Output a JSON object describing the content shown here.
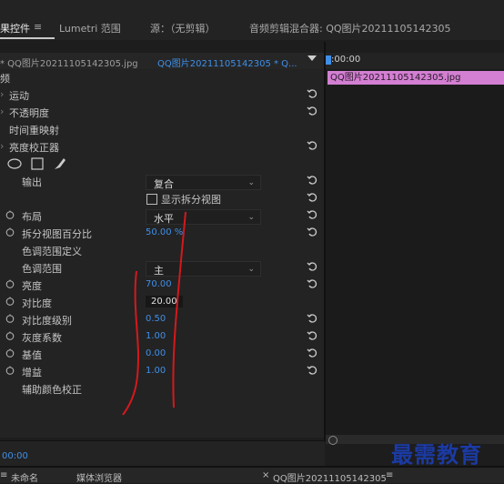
{
  "top_tabs": {
    "effect_controls": "果控件",
    "menu_glyph": "≡",
    "lumetri_scopes": "Lumetri 范围",
    "source": "源：（无剪辑）",
    "audio_mixer": "音频剪辑混合器: QQ图片20211105142305"
  },
  "source_header": {
    "master_clip": "* QQ图片20211105142305.jpg",
    "sequence_clip": "QQ图片20211105142305 * Q..."
  },
  "panel": {
    "fx_header": "频",
    "motion": "运动",
    "opacity": "不透明度",
    "time_remap": "时间重映射",
    "brightness_corrector": "亮度校正器",
    "output_label": "输出",
    "output_value": "复合",
    "show_split_view": "显示拆分视图",
    "layout_label": "布局",
    "layout_value": "水平",
    "split_percent_label": "拆分视图百分比",
    "split_percent_value": "50.00 %",
    "tonal_range_def": "色调范围定义",
    "tonal_range_label": "色调范围",
    "tonal_range_value": "主",
    "brightness_label": "亮度",
    "brightness_value": "70.00",
    "contrast_label": "对比度",
    "contrast_value": "20.00",
    "contrast_level_label": "对比度级别",
    "contrast_level_value": "0.50",
    "gamma_label": "灰度系数",
    "gamma_value": "1.00",
    "pedestal_label": "基值",
    "pedestal_value": "0.00",
    "gain_label": "增益",
    "gain_value": "1.00",
    "secondary_label": "辅助颜色校正"
  },
  "timeline": {
    "timecode": ":00:00",
    "clip_name": "QQ图片20211105142305.jpg"
  },
  "bottom": {
    "current_time": "00:00",
    "tab_untitled": "未命名",
    "tab_media_browser": "媒体浏览器",
    "tab_sequence": "QQ图片20211105142305",
    "menu_glyph": "≡",
    "close_glyph": "×"
  },
  "watermark": "最需教育",
  "colors": {
    "accent_blue": "#3f8fe8",
    "clip_pink": "#d37fd2",
    "annotation_red": "#d4191c"
  },
  "icons": [
    "reset-icon",
    "stopwatch-icon",
    "ellipse-mask-icon",
    "rectangle-mask-icon",
    "pen-mask-icon",
    "dropdown-caret-icon",
    "playhead-icon"
  ]
}
